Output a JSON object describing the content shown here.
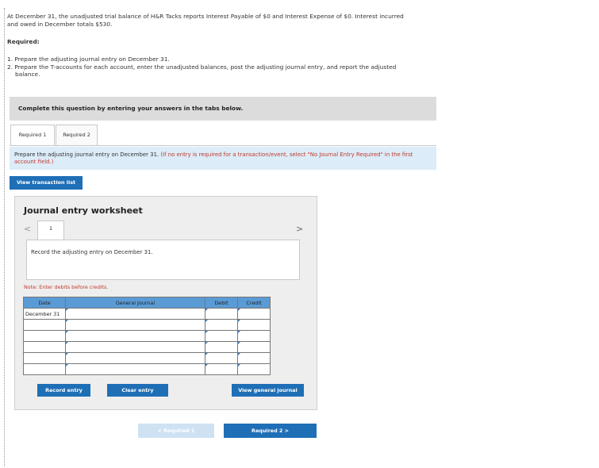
{
  "problem": {
    "intro_line1": "At December 31, the unadjusted trial balance of H&R Tacks reports Interest Payable of $0 and Interest Expense of $0. Interest incurred",
    "intro_line2": "and owed in December totals $530.",
    "required_label": "Required:",
    "req1": "1. Prepare the adjusting journal entry on December 31.",
    "req2_line1": "2. Prepare the T-accounts for each account, enter the unadjusted balances, post the adjusting journal entry, and report the adjusted",
    "req2_line2": "balance."
  },
  "instructions_bar": "Complete this question by entering your answers in the tabs below.",
  "tabs": [
    {
      "label": "Required 1",
      "active": true
    },
    {
      "label": "Required 2",
      "active": false
    }
  ],
  "info": {
    "text": "Prepare the adjusting journal entry on December 31.",
    "hint": "(If no entry is required for a transaction/event, select \"No Journal Entry Required\" in the first account field.)"
  },
  "buttons": {
    "view_transaction_list": "View transaction list",
    "record_entry": "Record entry",
    "clear_entry": "Clear entry",
    "view_general_journal": "View general journal",
    "prev_required": "< Required 1",
    "next_required": "Required 2 >"
  },
  "worksheet": {
    "title": "Journal entry worksheet",
    "prev_icon": "<",
    "next_icon": ">",
    "page": "1",
    "record_text": "Record the adjusting entry on December 31.",
    "note": "Note: Enter debits before credits."
  },
  "journal": {
    "headers": [
      "Date",
      "General Journal",
      "Debit",
      "Credit"
    ],
    "rows": [
      {
        "date": "December 31",
        "account": "",
        "debit": "",
        "credit": ""
      },
      {
        "date": "",
        "account": "",
        "debit": "",
        "credit": ""
      },
      {
        "date": "",
        "account": "",
        "debit": "",
        "credit": ""
      },
      {
        "date": "",
        "account": "",
        "debit": "",
        "credit": ""
      },
      {
        "date": "",
        "account": "",
        "debit": "",
        "credit": ""
      },
      {
        "date": "",
        "account": "",
        "debit": "",
        "credit": ""
      }
    ]
  },
  "colors": {
    "accent_blue": "#1f6fb7",
    "header_blue": "#5b9bd5",
    "info_bg": "#dcecf8",
    "note_red": "#c0392b"
  }
}
